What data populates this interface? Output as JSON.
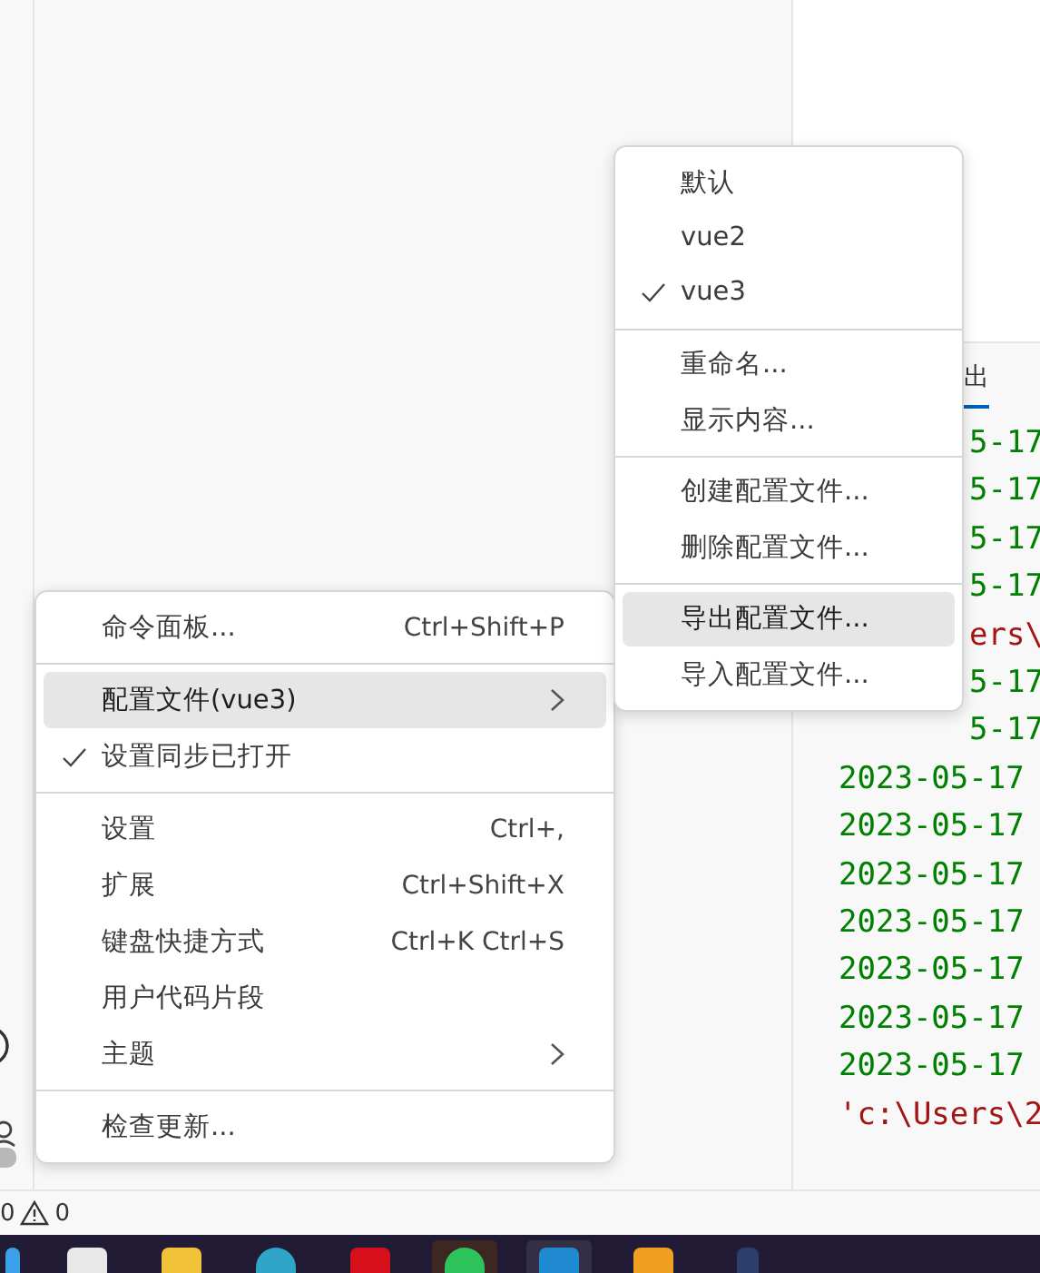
{
  "panel": {
    "tabs": [
      {
        "label": "出",
        "selected": true
      }
    ]
  },
  "output_lines": [
    {
      "text": "5-17",
      "kind": "date",
      "partial": true
    },
    {
      "text": "5-17",
      "kind": "date",
      "partial": true
    },
    {
      "text": "5-17",
      "kind": "date",
      "partial": true
    },
    {
      "text": "5-17",
      "kind": "date",
      "partial": true
    },
    {
      "text": "ers\\",
      "kind": "path",
      "partial": true
    },
    {
      "text": "5-17",
      "kind": "date",
      "partial": true
    },
    {
      "text": "5-17",
      "kind": "date",
      "partial": true
    },
    {
      "text": "2023-05-17",
      "kind": "date",
      "partial": false
    },
    {
      "text": "2023-05-17",
      "kind": "date",
      "partial": false
    },
    {
      "text": "2023-05-17",
      "kind": "date",
      "partial": false
    },
    {
      "text": "2023-05-17",
      "kind": "date",
      "partial": false
    },
    {
      "text": "2023-05-17",
      "kind": "date",
      "partial": false
    },
    {
      "text": "2023-05-17",
      "kind": "date",
      "partial": false
    },
    {
      "text": "2023-05-17",
      "kind": "date",
      "partial": false
    },
    {
      "text": "'c:\\Users\\2",
      "kind": "path",
      "partial": false
    }
  ],
  "menu": {
    "groups": [
      [
        {
          "label": "命令面板...",
          "shortcut": "Ctrl+Shift+P",
          "checked": false,
          "selected": false,
          "has_submenu": false
        }
      ],
      [
        {
          "label": "配置文件(vue3)",
          "checked": false,
          "selected": true,
          "has_submenu": true
        },
        {
          "label": "设置同步已打开",
          "checked": true,
          "selected": false,
          "has_submenu": false
        }
      ],
      [
        {
          "label": "设置",
          "shortcut": "Ctrl+,",
          "checked": false,
          "selected": false,
          "has_submenu": false
        },
        {
          "label": "扩展",
          "shortcut": "Ctrl+Shift+X",
          "checked": false,
          "selected": false,
          "has_submenu": false
        },
        {
          "label": "键盘快捷方式",
          "shortcut": "Ctrl+K Ctrl+S",
          "checked": false,
          "selected": false,
          "has_submenu": false
        },
        {
          "label": "用户代码片段",
          "checked": false,
          "selected": false,
          "has_submenu": false
        },
        {
          "label": "主题",
          "checked": false,
          "selected": false,
          "has_submenu": true
        }
      ],
      [
        {
          "label": "检查更新...",
          "checked": false,
          "selected": false,
          "has_submenu": false
        }
      ]
    ]
  },
  "submenu": {
    "groups": [
      [
        {
          "label": "默认",
          "checked": false,
          "selected": false
        },
        {
          "label": "vue2",
          "checked": false,
          "selected": false
        },
        {
          "label": "vue3",
          "checked": true,
          "selected": false
        }
      ],
      [
        {
          "label": "重命名...",
          "checked": false,
          "selected": false
        },
        {
          "label": "显示内容...",
          "checked": false,
          "selected": false
        }
      ],
      [
        {
          "label": "创建配置文件...",
          "checked": false,
          "selected": false
        },
        {
          "label": "删除配置文件...",
          "checked": false,
          "selected": false
        }
      ],
      [
        {
          "label": "导出配置文件...",
          "checked": false,
          "selected": true
        },
        {
          "label": "导入配置文件...",
          "checked": false,
          "selected": false
        }
      ]
    ]
  },
  "status_bar": {
    "errors": "0",
    "warnings": "0"
  }
}
